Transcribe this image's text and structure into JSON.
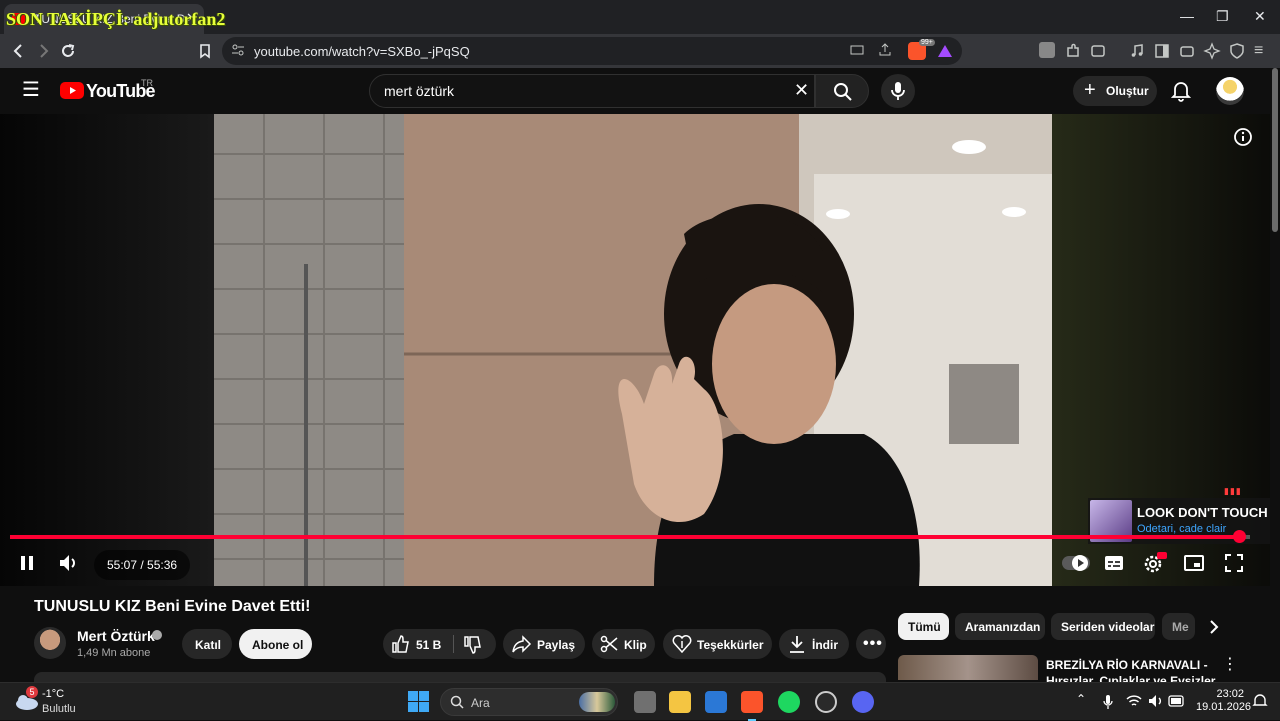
{
  "browser": {
    "tab_title": "TUNUSLU KIZ Beni Evine Davet Etti!",
    "overlay_text": "SON TAKİPÇİ: adjutorfan2",
    "url": "youtube.com/watch?v=SXBo_-jPqSQ",
    "window_controls": [
      "minimize-icon",
      "restore-icon",
      "close-icon"
    ],
    "brave_badge": "99+"
  },
  "youtube": {
    "logo_text": "YouTube",
    "logo_region": "TR",
    "search_query": "mert öztürk",
    "create_label": "Oluştur"
  },
  "player": {
    "current_time": "55:07",
    "duration": "55:36",
    "time_display": "55:07 / 55:36",
    "progress_fraction": 0.9913,
    "music_card": {
      "title": "LOOK DON'T TOUCH (V",
      "subtitle": "Odetari, cade clair"
    }
  },
  "video": {
    "title": "TUNUSLU KIZ Beni Evine Davet Etti!",
    "channel_name": "Mert Öztürk",
    "subscribers": "1,49 Mn abone",
    "join_label": "Katıl",
    "subscribe_label": "Abone ol",
    "like_count": "51 B",
    "share_label": "Paylaş",
    "clip_label": "Klip",
    "thanks_label": "Teşekkürler",
    "download_label": "İndir"
  },
  "filter_chips": [
    "Tümü",
    "Aramanızdan",
    "Seriden videolar",
    "Me"
  ],
  "recommendation": {
    "title": "BREZİLYA RİO KARNAVALI - Hırsızlar, Çıplaklar ve Evsizler"
  },
  "taskbar": {
    "weather_temp": "-1°C",
    "weather_desc": "Bulutlu",
    "weather_badge": "5",
    "search_placeholder": "Ara",
    "time": "23:02",
    "date": "19.01.2026"
  },
  "colors": {
    "accent_red": "#ff0033",
    "bg": "#0f0f0f",
    "link_blue": "#3ea6ff"
  }
}
